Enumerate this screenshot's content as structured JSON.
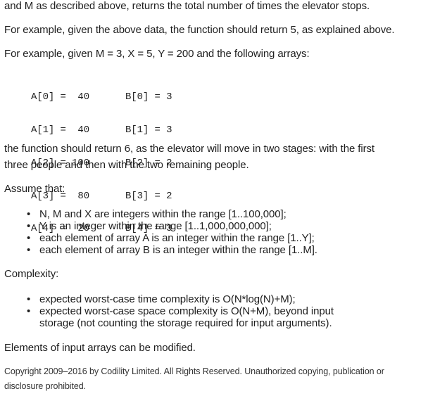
{
  "paragraphs": {
    "p1": "and M as described above, returns the total number of times the elevator stops.",
    "p2": "For example, given the above data, the function should return 5, as explained above.",
    "p3": "For example, given M = 3, X = 5, Y = 200 and the following arrays:",
    "p4a": "the function should return 6, as the elevator will move in two stages: with the first",
    "p4b": "three people and then with the two remaining people.",
    "p5": "Assume that:",
    "p6": "Complexity:",
    "p7": "Elements of input arrays can be modified."
  },
  "code_rows": [
    {
      "a": "A[0] =  40",
      "b": "B[0] = 3"
    },
    {
      "a": "A[1] =  40",
      "b": "B[1] = 3"
    },
    {
      "a": "A[2] = 100",
      "b": "B[2] = 2"
    },
    {
      "a": "A[3] =  80",
      "b": "B[3] = 2"
    },
    {
      "a": "A[4] =  20",
      "b": "B[4] = 3"
    }
  ],
  "assumptions": [
    "N, M and X are integers within the range [1..100,000];",
    "Y is an integer within the range [1..1,000,000,000];",
    "each element of array A is an integer within the range [1..Y];",
    "each element of array B is an integer within the range [1..M]."
  ],
  "complexity": [
    "expected worst-case time complexity is O(N*log(N)+M);",
    "expected worst-case space complexity is O(N+M), beyond input",
    "storage (not counting the storage required for input arguments)."
  ],
  "copyright": "Copyright 2009–2016 by Codility Limited. All Rights Reserved. Unauthorized copying, publication or disclosure prohibited."
}
